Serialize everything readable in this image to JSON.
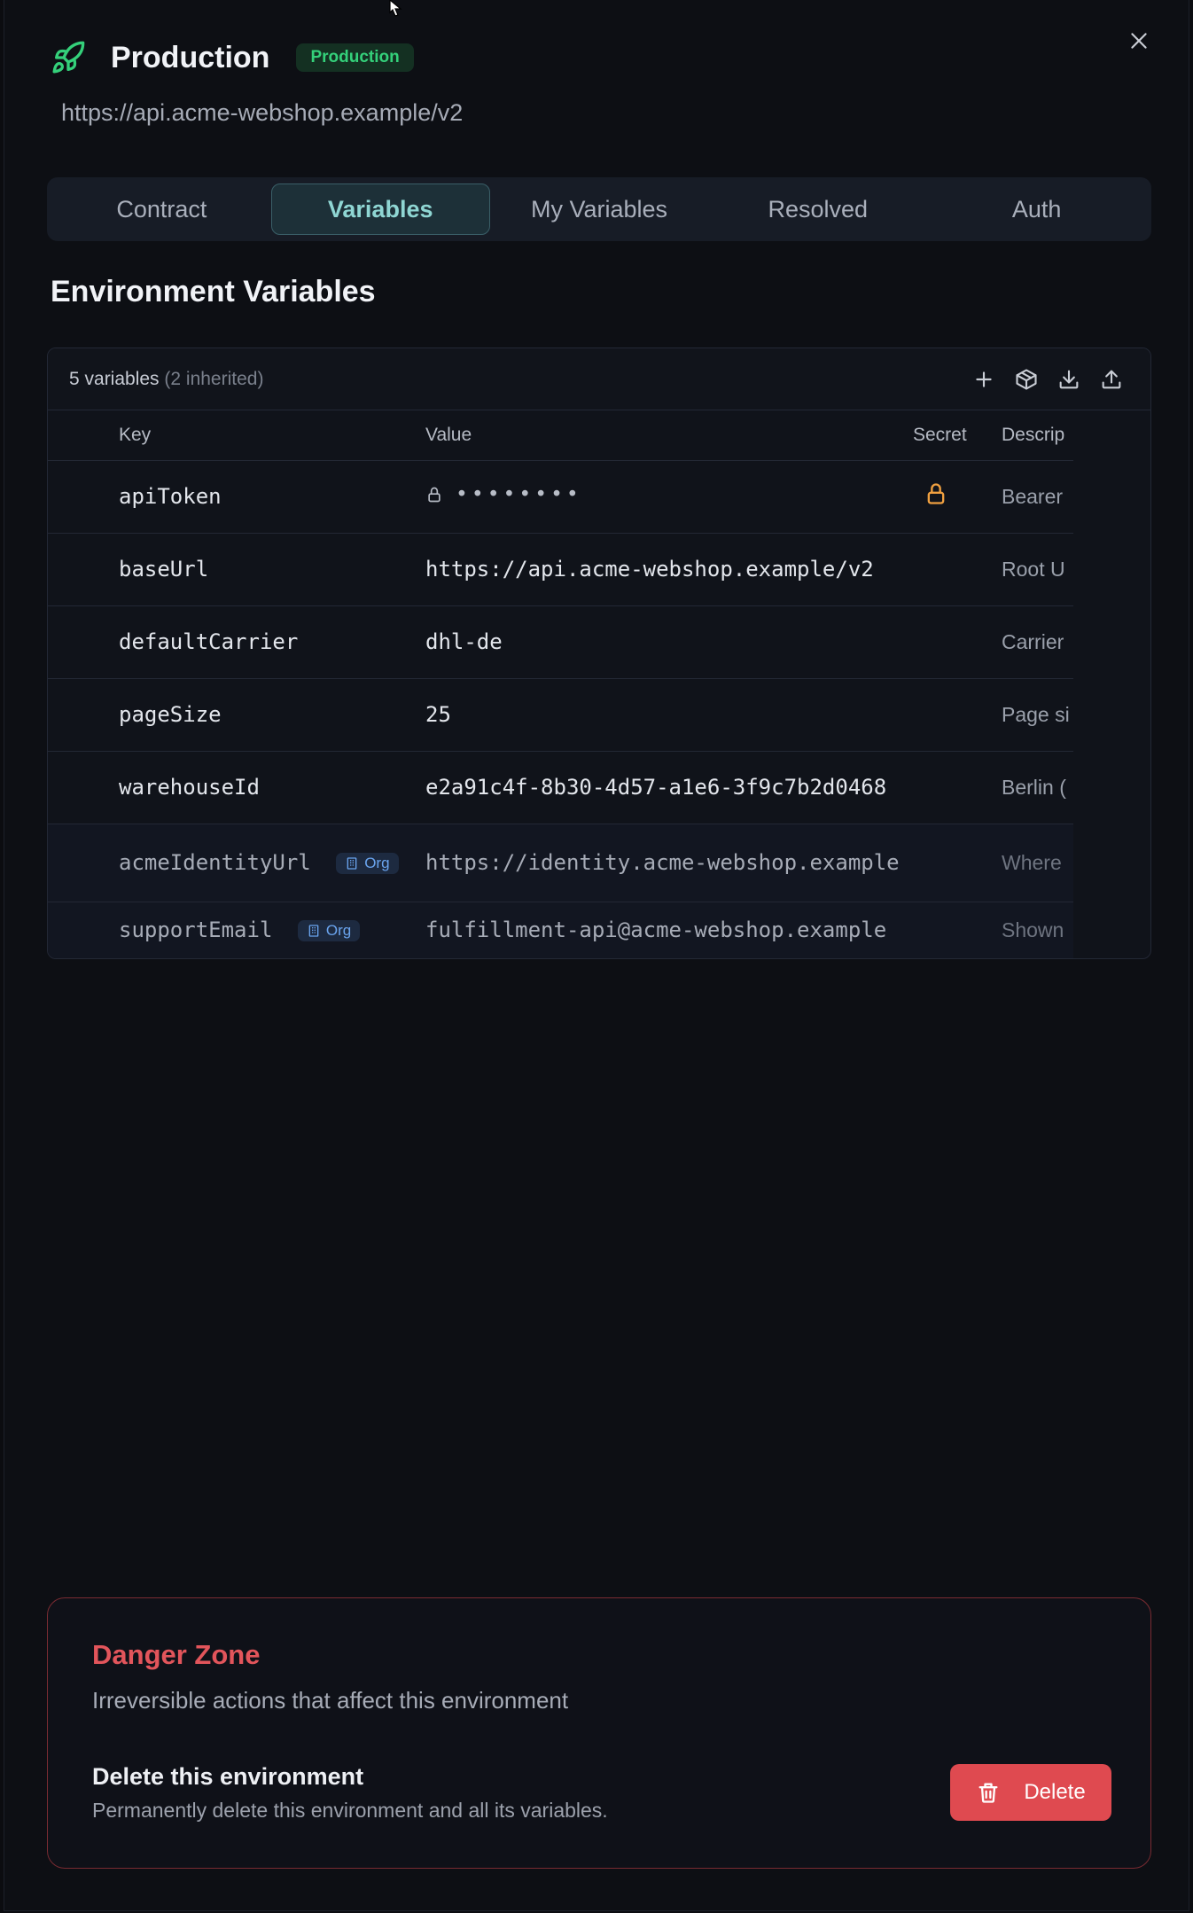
{
  "header": {
    "title": "Production",
    "badge": "Production",
    "url": "https://api.acme-webshop.example/v2"
  },
  "tabs": [
    {
      "label": "Contract",
      "active": false
    },
    {
      "label": "Variables",
      "active": true
    },
    {
      "label": "My Variables",
      "active": false
    },
    {
      "label": "Resolved",
      "active": false
    },
    {
      "label": "Auth",
      "active": false
    }
  ],
  "section_title": "Environment Variables",
  "table": {
    "count_label": "5 variables",
    "inherited_label": "(2 inherited)",
    "columns": {
      "key": "Key",
      "value": "Value",
      "secret": "Secret",
      "description": "Descrip"
    },
    "rows": [
      {
        "key": "apiToken",
        "value": "••••••••",
        "secret": true,
        "description": "Bearer"
      },
      {
        "key": "baseUrl",
        "value": "https://api.acme-webshop.example/v2",
        "secret": false,
        "description": "Root U"
      },
      {
        "key": "defaultCarrier",
        "value": "dhl-de",
        "secret": false,
        "description": "Carrier"
      },
      {
        "key": "pageSize",
        "value": "25",
        "secret": false,
        "description": "Page si"
      },
      {
        "key": "warehouseId",
        "value": "e2a91c4f-8b30-4d57-a1e6-3f9c7b2d0468",
        "secret": false,
        "description": "Berlin ("
      },
      {
        "key": "acmeIdentityUrl",
        "badge": "Org",
        "value": "https://identity.acme-webshop.example",
        "secret": false,
        "description": "Where"
      },
      {
        "key": "supportEmail",
        "badge": "Org",
        "value": "fulfillment-api@acme-webshop.example",
        "secret": false,
        "description": "Shown"
      }
    ]
  },
  "danger_zone": {
    "title": "Danger Zone",
    "subtitle": "Irreversible actions that affect this environment",
    "item_title": "Delete this environment",
    "item_subtitle": "Permanently delete this environment and all its variables.",
    "button_label": "Delete"
  },
  "icons": {
    "rocket": "rocket-icon",
    "close": "close-icon",
    "add": "plus-icon",
    "package": "package-icon",
    "download": "download-icon",
    "upload": "upload-icon",
    "lock": "lock-icon",
    "building": "building-icon",
    "trash": "trash-icon"
  },
  "colors": {
    "accent": "#8fd6d3",
    "success": "#34d07a",
    "danger": "#df4a50",
    "secret": "#f0a040",
    "org": "#6aa4ee"
  }
}
